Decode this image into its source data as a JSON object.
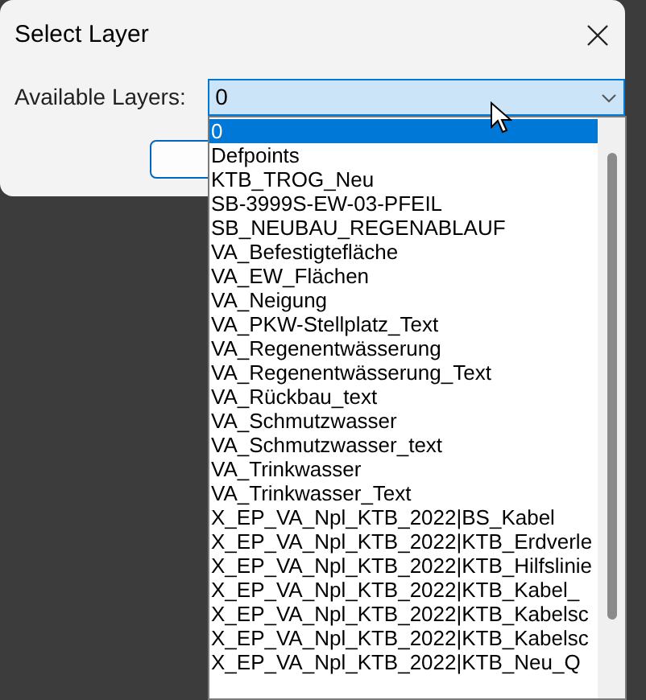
{
  "dialog": {
    "title": "Select Layer",
    "field_label": "Available Layers:",
    "combo_value": "0"
  },
  "layers": [
    {
      "name": "0",
      "selected": true
    },
    {
      "name": "Defpoints",
      "selected": false
    },
    {
      "name": "KTB_TROG_Neu",
      "selected": false
    },
    {
      "name": "SB-3999S-EW-03-PFEIL",
      "selected": false
    },
    {
      "name": "SB_NEUBAU_REGENABLAUF",
      "selected": false
    },
    {
      "name": "VA_Befestigtefläche",
      "selected": false
    },
    {
      "name": "VA_EW_Flächen",
      "selected": false
    },
    {
      "name": "VA_Neigung",
      "selected": false
    },
    {
      "name": "VA_PKW-Stellplatz_Text",
      "selected": false
    },
    {
      "name": "VA_Regenentwässerung",
      "selected": false
    },
    {
      "name": "VA_Regenentwässerung_Text",
      "selected": false
    },
    {
      "name": "VA_Rückbau_text",
      "selected": false
    },
    {
      "name": "VA_Schmutzwasser",
      "selected": false
    },
    {
      "name": "VA_Schmutzwasser_text",
      "selected": false
    },
    {
      "name": "VA_Trinkwasser",
      "selected": false
    },
    {
      "name": "VA_Trinkwasser_Text",
      "selected": false
    },
    {
      "name": "X_EP_VA_Npl_KTB_2022|BS_Kabel",
      "selected": false
    },
    {
      "name": "X_EP_VA_Npl_KTB_2022|KTB_Erdverle",
      "selected": false
    },
    {
      "name": "X_EP_VA_Npl_KTB_2022|KTB_Hilfslinie",
      "selected": false
    },
    {
      "name": "X_EP_VA_Npl_KTB_2022|KTB_Kabel_",
      "selected": false
    },
    {
      "name": "X_EP_VA_Npl_KTB_2022|KTB_Kabelsc",
      "selected": false
    },
    {
      "name": "X_EP_VA_Npl_KTB_2022|KTB_Kabelsc",
      "selected": false
    },
    {
      "name": "X_EP_VA_Npl_KTB_2022|KTB_Neu_Q",
      "selected": false
    }
  ]
}
